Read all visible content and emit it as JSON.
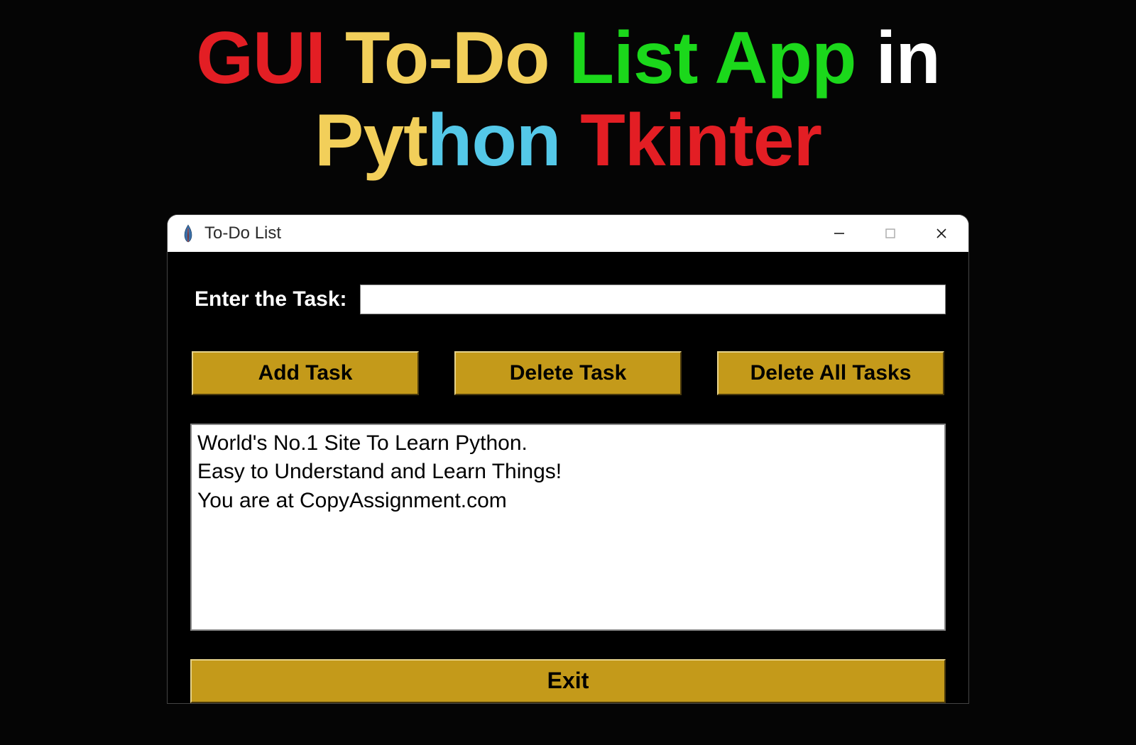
{
  "heading": {
    "line1": {
      "w1": "GUI",
      "w2": "To-Do",
      "w3": "List App",
      "w4": "in"
    },
    "line2": {
      "w1a": "Pyt",
      "w1b": "hon",
      "w2": "Tkinter"
    }
  },
  "window": {
    "title": "To-Do List"
  },
  "form": {
    "label": "Enter the Task:",
    "input_value": ""
  },
  "buttons": {
    "add": "Add Task",
    "delete": "Delete Task",
    "delete_all": "Delete All Tasks",
    "exit": "Exit"
  },
  "tasks": [
    "World's No.1 Site To Learn Python.",
    "Easy to Understand and Learn Things!",
    "You are at CopyAssignment.com"
  ]
}
